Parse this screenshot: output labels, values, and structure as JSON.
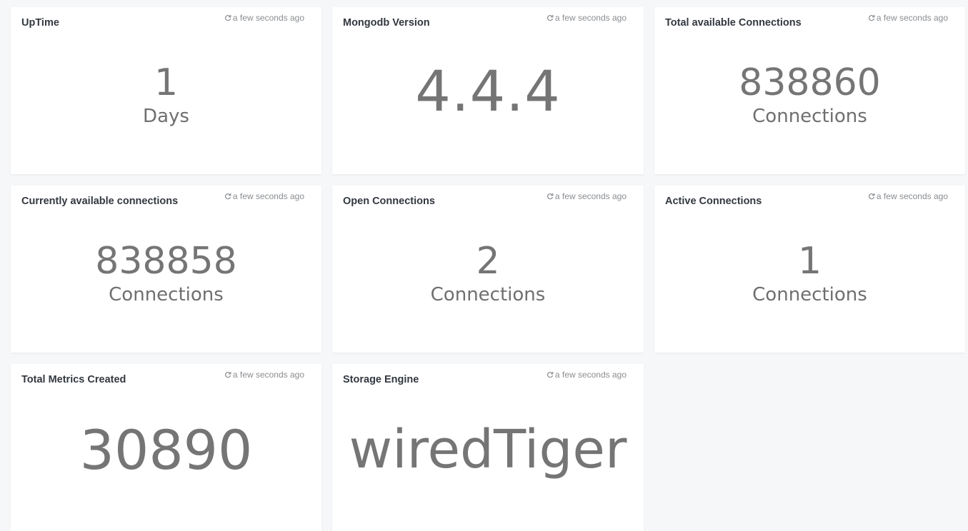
{
  "cards": [
    {
      "title": "UpTime",
      "refresh": "a few seconds ago",
      "value": "1",
      "unit": "Days"
    },
    {
      "title": "Mongodb Version",
      "refresh": "a few seconds ago",
      "value": "4.4.4",
      "unit": ""
    },
    {
      "title": "Total available Connections",
      "refresh": "a few seconds ago",
      "value": "838860",
      "unit": "Connections"
    },
    {
      "title": "Currently available connections",
      "refresh": "a few seconds ago",
      "value": "838858",
      "unit": "Connections"
    },
    {
      "title": "Open Connections",
      "refresh": "a few seconds ago",
      "value": "2",
      "unit": "Connections"
    },
    {
      "title": "Active Connections",
      "refresh": "a few seconds ago",
      "value": "1",
      "unit": "Connections"
    },
    {
      "title": "Total Metrics Created",
      "refresh": "a few seconds ago",
      "value": "30890",
      "unit": ""
    },
    {
      "title": "Storage Engine",
      "refresh": "a few seconds ago",
      "value": "wiredTiger",
      "unit": ""
    }
  ],
  "icons": {
    "refresh": "refresh-icon"
  }
}
